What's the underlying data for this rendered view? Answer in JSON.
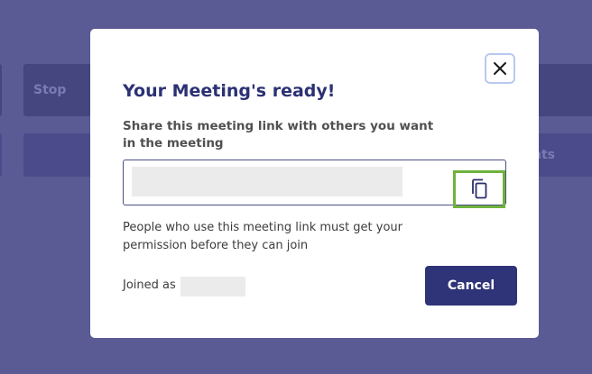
{
  "background": {
    "stop_label": "Stop",
    "right_button_label_partial": "nts"
  },
  "modal": {
    "title": "Your Meeting's ready!",
    "share_label": "Share this meeting link with others you want in the meeting",
    "meeting_link": "",
    "permission_note": "People who use this meeting link must get your permission before they can join",
    "joined_as_label": "Joined as",
    "joined_as_name": "",
    "cancel_label": "Cancel",
    "close_icon": "close-icon",
    "copy_icon": "copy-icon"
  },
  "colors": {
    "overlay": "#5a5a94",
    "title": "#2b3173",
    "primary_button": "#2f3377",
    "copy_highlight": "#6fb33b",
    "close_focus_ring": "#b9c9ee"
  }
}
